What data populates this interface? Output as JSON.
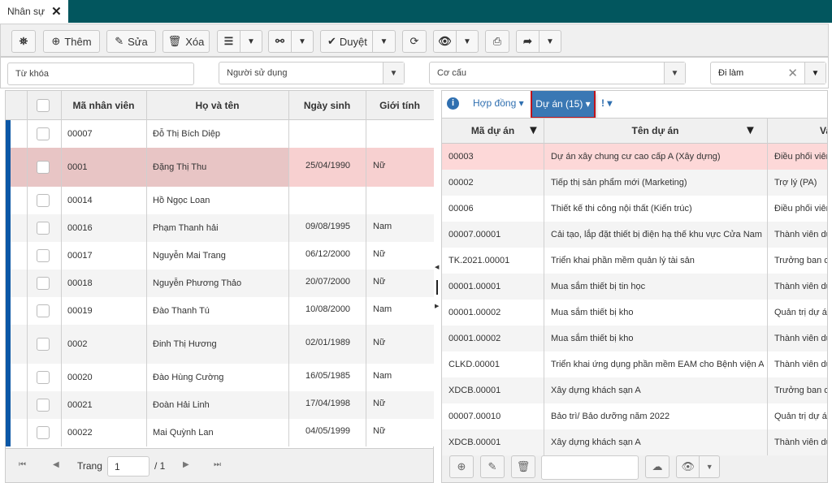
{
  "window": {
    "tab_label": "Nhân sự",
    "tab_close": "✕",
    "header_color": "#02565e"
  },
  "toolbar": {
    "them": "Thêm",
    "sua": "Sửa",
    "xoa": "Xóa",
    "duyet": "Duyệt"
  },
  "filters": {
    "keyword_placeholder": "Từ khóa",
    "user_placeholder": "Người sử dụng",
    "structure_placeholder": "Cơ cấu",
    "status_value": "Đi làm"
  },
  "left_table": {
    "columns": [
      "Mã nhân viên",
      "Họ và tên",
      "Ngày sinh",
      "Giới tính"
    ],
    "rows": [
      {
        "code": "00007",
        "name": "Đỗ Thị Bích Diệp",
        "dob": "",
        "gender": ""
      },
      {
        "code": "0001",
        "name": "Đặng Thị Thu",
        "dob": "25/04/1990",
        "gender": "Nữ",
        "selected": true
      },
      {
        "code": "00014",
        "name": "Hồ Ngọc Loan",
        "dob": "",
        "gender": ""
      },
      {
        "code": "00016",
        "name": "Phạm Thanh hải",
        "dob": "09/08/1995",
        "gender": "Nam"
      },
      {
        "code": "00017",
        "name": "Nguyễn Mai Trang",
        "dob": "06/12/2000",
        "gender": "Nữ"
      },
      {
        "code": "00018",
        "name": "Nguyễn Phương Thảo",
        "dob": "20/07/2000",
        "gender": "Nữ"
      },
      {
        "code": "00019",
        "name": "Đào Thanh Tú",
        "dob": "10/08/2000",
        "gender": "Nam"
      },
      {
        "code": "0002",
        "name": "Đinh Thị Hương",
        "dob": "02/01/1989",
        "gender": "Nữ"
      },
      {
        "code": "00020",
        "name": "Đào Hùng Cường",
        "dob": "16/05/1985",
        "gender": "Nam"
      },
      {
        "code": "00021",
        "name": "Đoàn Hải Linh",
        "dob": "17/04/1998",
        "gender": "Nữ"
      },
      {
        "code": "00022",
        "name": "Mai Quỳnh Lan",
        "dob": "04/05/1999",
        "gender": "Nữ"
      }
    ],
    "pager": {
      "label": "Trang",
      "page": "1",
      "total": "/ 1"
    }
  },
  "right_panel": {
    "tabs": {
      "contract": "Hợp đồng",
      "project": "Dự án (15)"
    },
    "columns": [
      "Mã dự án",
      "Tên dự án",
      "Va"
    ],
    "rows": [
      {
        "code": "00003",
        "name": "Dự án xây chung cư cao cấp A (Xây dựng)",
        "role": "Điều phối viên",
        "selected": true
      },
      {
        "code": "00002",
        "name": "Tiếp thị sản phẩm mới (Marketing)",
        "role": "Trợ lý (PA)"
      },
      {
        "code": "00006",
        "name": "Thiết kế thi công nội thất (Kiến trúc)",
        "role": "Điều phối viên"
      },
      {
        "code": "00007.00001",
        "name": "Cải tạo, lắp đặt thiết bị điện hạ thế khu vực Cửa Nam",
        "role": "Thành viên dự án"
      },
      {
        "code": "TK.2021.00001",
        "name": "Triển khai phần mềm quản lý tài sản",
        "role": "Trưởng ban chỉ đạo"
      },
      {
        "code": "00001.00001",
        "name": "Mua sắm thiết bị tin học",
        "role": "Thành viên dự án"
      },
      {
        "code": "00001.00002",
        "name": "Mua sắm thiết bị kho",
        "role": "Quản trị dự án"
      },
      {
        "code": "00001.00002",
        "name": "Mua sắm thiết bị kho",
        "role": "Thành viên dự án"
      },
      {
        "code": "CLKD.00001",
        "name": "Triển khai ứng dụng phần mềm EAM cho Bệnh viện A",
        "role": "Thành viên dự án"
      },
      {
        "code": "XDCB.00001",
        "name": "Xây dựng khách sạn A",
        "role": "Trưởng ban chỉ đạo"
      },
      {
        "code": "00007.00010",
        "name": "Bảo trì/ Bảo dưỡng năm 2022",
        "role": "Quản trị dự án"
      },
      {
        "code": "XDCB.00001",
        "name": "Xây dựng khách sạn A",
        "role": "Thành viên dự án"
      }
    ],
    "search_value": ""
  }
}
